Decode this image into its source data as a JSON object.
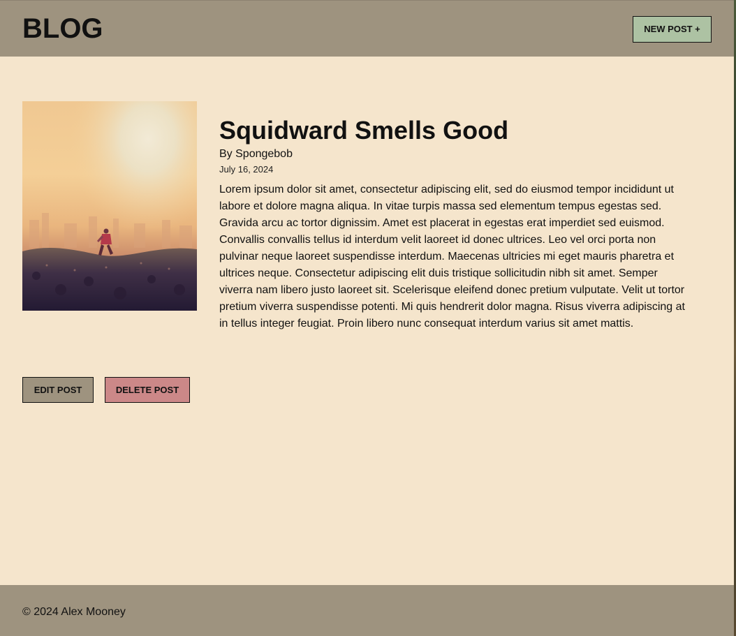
{
  "header": {
    "brand": "BLOG",
    "new_post_label": "NEW POST +"
  },
  "post": {
    "image_alt": "Person running through a field toward a city skyline at sunrise",
    "title": "Squidward Smells Good",
    "author": "By Spongebob",
    "date": "July 16, 2024",
    "body": "Lorem ipsum dolor sit amet, consectetur adipiscing elit, sed do eiusmod tempor incididunt ut labore et dolore magna aliqua. In vitae turpis massa sed elementum tempus egestas sed. Gravida arcu ac tortor dignissim. Amet est placerat in egestas erat imperdiet sed euismod. Convallis convallis tellus id interdum velit laoreet id donec ultrices. Leo vel orci porta non pulvinar neque laoreet suspendisse interdum. Maecenas ultricies mi eget mauris pharetra et ultrices neque. Consectetur adipiscing elit duis tristique sollicitudin nibh sit amet. Semper viverra nam libero justo laoreet sit. Scelerisque eleifend donec pretium vulputate. Velit ut tortor pretium viverra suspendisse potenti. Mi quis hendrerit dolor magna. Risus viverra adipiscing at in tellus integer feugiat. Proin libero nunc consequat interdum varius sit amet mattis."
  },
  "actions": {
    "edit_label": "EDIT POST",
    "delete_label": "DELETE POST"
  },
  "footer": {
    "copyright": "© 2024 Alex Mooney"
  },
  "colors": {
    "page_background": "#f5e5cc",
    "header_footer_background": "#9e937f",
    "new_post_button": "#adc2a3",
    "delete_button": "#cc8888",
    "text": "#111111"
  }
}
